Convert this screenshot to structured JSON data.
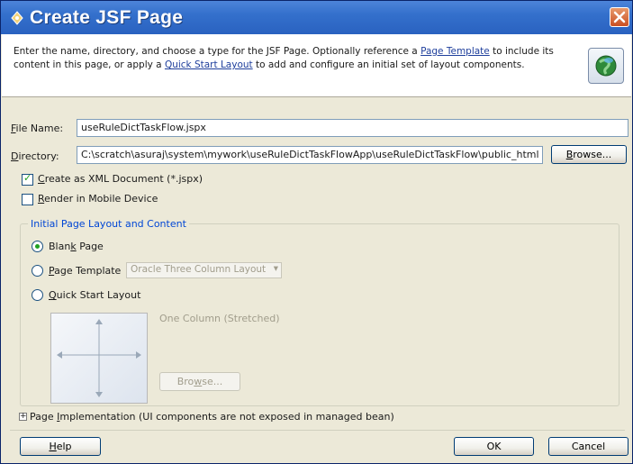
{
  "window": {
    "title": "Create JSF Page",
    "accent_color": "#3470cc",
    "icons": {
      "title": "jdev-icon",
      "close": "close-icon",
      "header": "globe-icon"
    }
  },
  "header": {
    "text_1": "Enter the name, directory, and choose a type for the JSF Page. Optionally reference a ",
    "link_page_template": "Page Template",
    "text_2": " to include its content in this page, or apply a ",
    "link_quick_start": "Quick Start Layout",
    "text_3": " to add and configure an initial set of layout components."
  },
  "form": {
    "file_name_mnemonic": "F",
    "file_name_label_rest": "ile Name:",
    "file_name_value": "useRuleDictTaskFlow.jspx",
    "directory_mnemonic": "D",
    "directory_label_rest": "irectory:",
    "directory_value": "C:\\scratch\\asuraj\\system\\mywork\\useRuleDictTaskFlowApp\\useRuleDictTaskFlow\\public_html",
    "browse_mnemonic": "B",
    "browse_rest": "rowse...",
    "xml_mnemonic": "C",
    "xml_label_rest": "reate as XML Document (*.jspx)",
    "xml_checked": true,
    "mobile_mnemonic": "R",
    "mobile_label_rest": "ender in Mobile Device",
    "mobile_checked": false
  },
  "layout_group": {
    "title": "Initial Page Layout and Content",
    "blank_label_pre": "Blan",
    "blank_mnemonic": "k",
    "blank_label_post": " Page",
    "template_mnemonic": "P",
    "template_label_rest": "age Template",
    "template_select": "Oracle Three Column Layout",
    "quick_mnemonic": "Q",
    "quick_label_rest": "uick Start Layout",
    "preview_caption": "One Column (Stretched)",
    "preview_browse_pre": "Bro",
    "preview_browse_mnemonic": "w",
    "preview_browse_post": "se...",
    "selected": "Blank Page"
  },
  "implementation": {
    "expander": "+",
    "label_pre": "Page ",
    "label_mnemonic": "I",
    "label_rest": "mplementation",
    "note": " (UI components are not exposed in managed bean)"
  },
  "buttons": {
    "help_mnemonic": "H",
    "help_rest": "elp",
    "ok": "OK",
    "cancel": "Cancel"
  }
}
